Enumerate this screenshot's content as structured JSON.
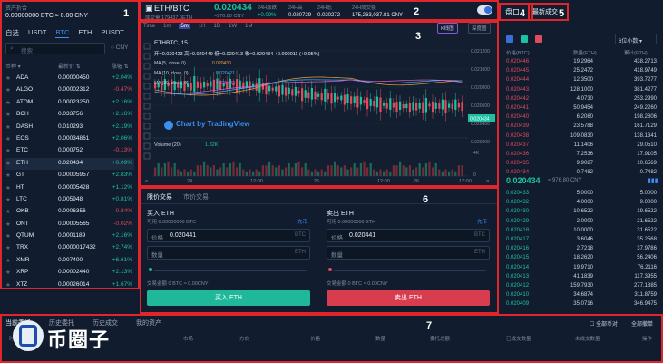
{
  "left": {
    "asset_label": "资产折合",
    "balance": "0.00000000 BTC ≈ 0.00 CNY",
    "tabs": [
      "自选",
      "USDT",
      "BTC",
      "ETH",
      "PUSDT"
    ],
    "search_placeholder": "搜索",
    "cny_label": "CNY",
    "headers": {
      "coin": "币种 ▾",
      "price": "最新价 ⇅",
      "change": "涨幅 ⇅"
    },
    "rows": [
      {
        "coin": "ADA",
        "price": "0.00000450",
        "change": "+2.04%",
        "up": true
      },
      {
        "coin": "ALGO",
        "price": "0.00002312",
        "change": "-0.47%",
        "up": false
      },
      {
        "coin": "ATOM",
        "price": "0.00023250",
        "change": "+2.16%",
        "up": true
      },
      {
        "coin": "BCH",
        "price": "0.033756",
        "change": "+2.16%",
        "up": true
      },
      {
        "coin": "DASH",
        "price": "0.010293",
        "change": "+2.19%",
        "up": true
      },
      {
        "coin": "EOS",
        "price": "0.00034861",
        "change": "+2.06%",
        "up": true
      },
      {
        "coin": "ETC",
        "price": "0.000752",
        "change": "-0.13%",
        "up": false
      },
      {
        "coin": "ETH",
        "price": "0.020434",
        "change": "+0.09%",
        "up": true
      },
      {
        "coin": "GT",
        "price": "0.00005957",
        "change": "+2.83%",
        "up": true
      },
      {
        "coin": "HT",
        "price": "0.00005428",
        "change": "+1.12%",
        "up": true
      },
      {
        "coin": "LTC",
        "price": "0.005948",
        "change": "+0.81%",
        "up": true
      },
      {
        "coin": "OKB",
        "price": "0.0006356",
        "change": "-0.84%",
        "up": false
      },
      {
        "coin": "ONT",
        "price": "0.00005565",
        "change": "-0.02%",
        "up": false
      },
      {
        "coin": "QTUM",
        "price": "0.0001189",
        "change": "+2.16%",
        "up": true
      },
      {
        "coin": "TRX",
        "price": "0.0000017432",
        "change": "+2.74%",
        "up": true
      },
      {
        "coin": "XMR",
        "price": "0.007400",
        "change": "+6.61%",
        "up": true
      },
      {
        "coin": "XRP",
        "price": "0.00002440",
        "change": "+2.13%",
        "up": true
      },
      {
        "coin": "XTZ",
        "price": "0.00026014",
        "change": "+1.67%",
        "up": true
      }
    ]
  },
  "top": {
    "pair": "ETH/BTC",
    "last": "0.020434",
    "last_sub": "成交量 179437.0ETH",
    "cny": "≈976.80 CNY",
    "change_label": "24H涨跌",
    "change": "+0.09%",
    "high_label": "24H高",
    "high": "0.020729",
    "low_label": "24H低",
    "low": "0.020272",
    "vol_label": "24H成交额",
    "vol": "175,263,037.81 CNY"
  },
  "chart": {
    "toolbar": [
      "Time",
      "1m",
      "5m",
      "1H",
      "1D",
      "1W",
      "1M"
    ],
    "toolbar_active": "5m",
    "kline_tab": "K线图",
    "depth_tab": "深度图",
    "symbol": "ETHBTC, 15",
    "ohlc": "开=0.020423 高=0.020449 低=0.020413 收=0.020434 +0.000011 (+0.05%)",
    "ma1": "MA (5, close, 0)",
    "ma1v": "0.020430",
    "ma2": "MA (10, close, 0)",
    "ma2v": "0.020421",
    "ma3": "MA (30, close, 0)",
    "ma3v": "0.020422",
    "watermark": "Chart by TradingView",
    "volume_label": "Volume (20)",
    "volume_val": "1.32K",
    "y_ticks": [
      "0.021200",
      "0.021000",
      "0.020800",
      "0.020600",
      "0.020400",
      "0.020200"
    ],
    "current_tag": "0.020434",
    "vol_ticks": [
      "4K",
      "0"
    ],
    "x_ticks": [
      "24",
      "12:00",
      "25",
      "12:00",
      "26",
      "12:00"
    ],
    "nav_left": "«",
    "nav_right": "»"
  },
  "orderbook": {
    "tab_book": "盘口",
    "tab_trades": "最新成交",
    "decimals": "6位小数",
    "headers": {
      "price": "价格(BTC)",
      "qty": "数量(ETH)",
      "total": "累计(ETH)"
    },
    "asks": [
      {
        "p": "0.020446",
        "q": "19.2964",
        "t": "438.2713"
      },
      {
        "p": "0.020445",
        "q": "25.2472",
        "t": "418.9749"
      },
      {
        "p": "0.020444",
        "q": "12.3500",
        "t": "393.7277"
      },
      {
        "p": "0.020443",
        "q": "128.1000",
        "t": "381.4277"
      },
      {
        "p": "0.020442",
        "q": "4.0730",
        "t": "253.2990"
      },
      {
        "p": "0.020441",
        "q": "50.9454",
        "t": "249.2260"
      },
      {
        "p": "0.020440",
        "q": "6.2060",
        "t": "198.2806"
      },
      {
        "p": "0.020439",
        "q": "23.5788",
        "t": "161.7129"
      },
      {
        "p": "0.020438",
        "q": "109.0830",
        "t": "138.1341"
      },
      {
        "p": "0.020437",
        "q": "11.1406",
        "t": "29.0510"
      },
      {
        "p": "0.020436",
        "q": "7.2536",
        "t": "17.9105"
      },
      {
        "p": "0.020435",
        "q": "9.9087",
        "t": "10.6569"
      },
      {
        "p": "0.020434",
        "q": "0.7482",
        "t": "0.7482"
      }
    ],
    "mid_price": "0.020434",
    "mid_cny": "≈ 976.80 CNY",
    "bids": [
      {
        "p": "0.020433",
        "q": "5.0000",
        "t": "5.0000"
      },
      {
        "p": "0.020432",
        "q": "4.0000",
        "t": "9.0000"
      },
      {
        "p": "0.020430",
        "q": "10.6522",
        "t": "19.6522"
      },
      {
        "p": "0.020429",
        "q": "2.0000",
        "t": "21.6522"
      },
      {
        "p": "0.020418",
        "q": "10.0000",
        "t": "31.6522"
      },
      {
        "p": "0.020417",
        "q": "3.6046",
        "t": "35.2568"
      },
      {
        "p": "0.020416",
        "q": "2.7218",
        "t": "37.9786"
      },
      {
        "p": "0.020415",
        "q": "18.2620",
        "t": "56.2406"
      },
      {
        "p": "0.020414",
        "q": "19.9710",
        "t": "76.2116"
      },
      {
        "p": "0.020413",
        "q": "41.1839",
        "t": "117.3955"
      },
      {
        "p": "0.020412",
        "q": "159.7930",
        "t": "277.1885"
      },
      {
        "p": "0.020410",
        "q": "34.6874",
        "t": "311.8759"
      },
      {
        "p": "0.020409",
        "q": "35.0716",
        "t": "346.9475"
      }
    ]
  },
  "trade": {
    "tab_limit": "限价交易",
    "tab_market": "市价交易",
    "buy_title": "买入 ETH",
    "buy_avail": "可用 0.00000000 BTC",
    "buy_deposit": "充币",
    "sell_title": "卖出 ETH",
    "sell_avail": "可用 0.00000000 ETH",
    "sell_deposit": "充币",
    "price_label": "价格",
    "qty_label": "数量",
    "buy_price": "0.020441",
    "sell_price": "0.020441",
    "unit_btc": "BTC",
    "unit_eth": "ETH",
    "buy_total": "交易金额 0 BTC ≈ 0.00CNY",
    "sell_total": "交易金额 0 BTC ≈ 0.00CNY",
    "buy_button": "买入 ETH",
    "sell_button": "卖出 ETH"
  },
  "bottom": {
    "tabs": [
      "当前委托",
      "历史委托",
      "历史成交",
      "我的资产"
    ],
    "all_pairs": "全部币对",
    "all_cancel": "全部撤单",
    "columns": [
      "时间",
      "市场",
      "方向",
      "价格",
      "数量",
      "委托总额",
      "已成交数量",
      "未成交数量",
      "操作"
    ],
    "logo_text": "币圈子"
  },
  "labels": [
    "1",
    "2",
    "3",
    "4",
    "5",
    "6",
    "7"
  ]
}
